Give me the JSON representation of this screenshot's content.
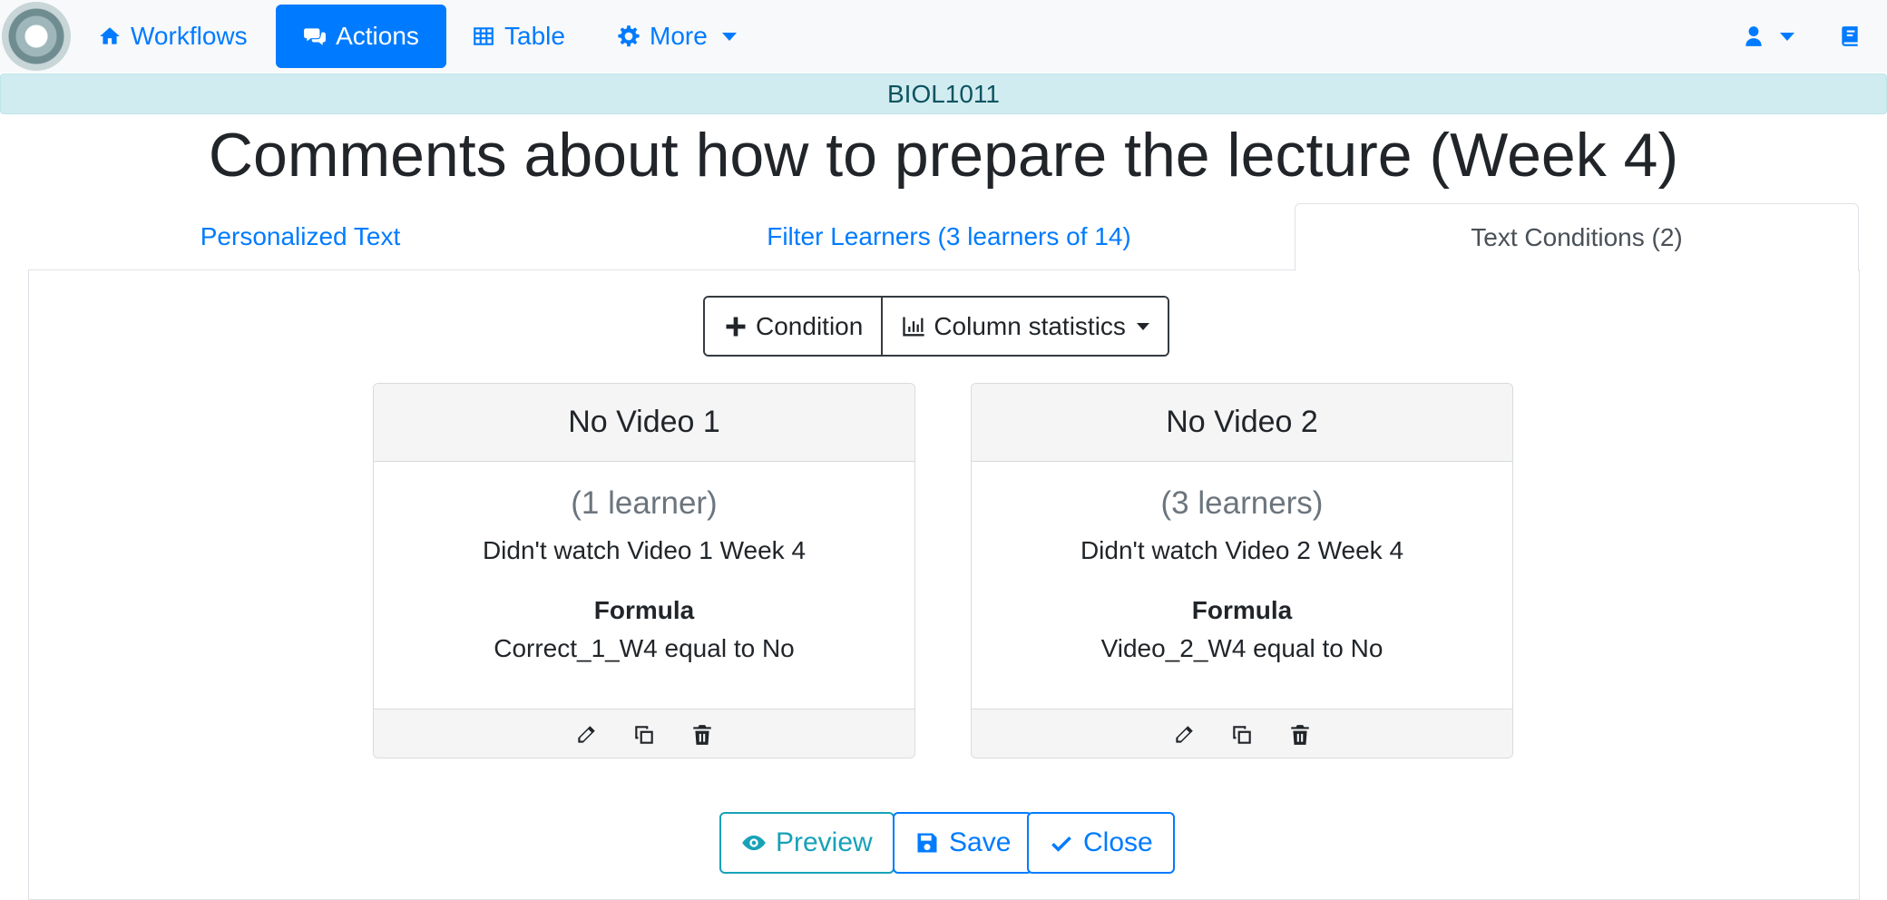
{
  "nav": {
    "items": [
      {
        "label": "Workflows",
        "icon": "home-icon"
      },
      {
        "label": "Actions",
        "icon": "comments-icon",
        "active": true
      },
      {
        "label": "Table",
        "icon": "table-icon"
      },
      {
        "label": "More",
        "icon": "gear-icon",
        "dropdown": true
      }
    ],
    "user_icon": "user-icon",
    "docs_icon": "book-icon"
  },
  "course": "BIOL1011",
  "page_title": "Comments about how to prepare the lecture (Week 4)",
  "tabs": [
    {
      "label": "Personalized Text"
    },
    {
      "label": "Filter Learners (3 learners of 14)"
    },
    {
      "label": "Text Conditions (2)",
      "active": true
    }
  ],
  "toolbar": {
    "condition_label": "Condition",
    "stats_label": "Column statistics"
  },
  "conditions": [
    {
      "name": "No Video 1",
      "count": "(1 learner)",
      "description": "Didn't watch Video 1 Week 4",
      "formula_label": "Formula",
      "formula": "Correct_1_W4 equal to No"
    },
    {
      "name": "No Video 2",
      "count": "(3 learners)",
      "description": "Didn't watch Video 2 Week 4",
      "formula_label": "Formula",
      "formula": "Video_2_W4 equal to No"
    }
  ],
  "buttons": {
    "preview": "Preview",
    "save": "Save",
    "close": "Close"
  },
  "colors": {
    "primary": "#007bff",
    "info": "#17a2b8",
    "banner_bg": "#d1ecf1",
    "banner_text": "#0c5460"
  }
}
